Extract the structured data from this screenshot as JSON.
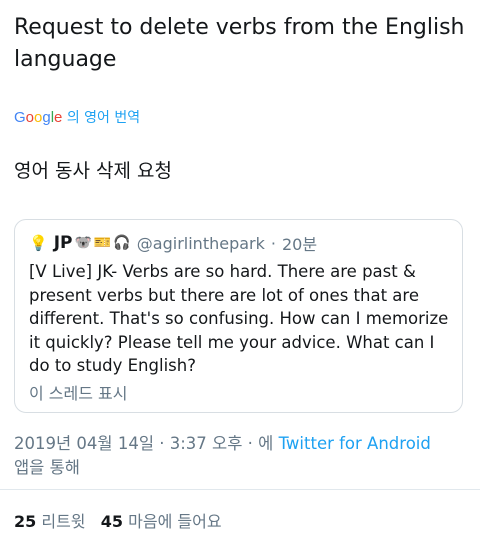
{
  "tweet": {
    "text": "Request to delete verbs from the English language"
  },
  "translation": {
    "provider": "Google",
    "label": "의 영어 번역",
    "text": "영어 동사 삭제 요청"
  },
  "quote": {
    "author_name": "JP",
    "emojis": [
      "🐨",
      "🎫",
      "🎧"
    ],
    "handle": "@agirlinthepark",
    "separator": "·",
    "time": "20분",
    "text": "[V Live] JK- Verbs are so hard. There are past & present verbs but there are lot of ones that are different. That's so confusing. How can I memorize it quickly? Please tell me your advice. What can I do to study English?",
    "show_thread": "이 스레드 표시"
  },
  "meta": {
    "timestamp": "2019년 04월 14일 · 3:37 오후 · 에",
    "app": "Twitter for Android",
    "suffix": "앱을 통해"
  },
  "stats": {
    "retweets_count": "25",
    "retweets_label": "리트윗",
    "likes_count": "45",
    "likes_label": "마음에 들어요"
  },
  "colors": {
    "link": "#1da1f2",
    "secondary_text": "#657786",
    "primary_text": "#14171a"
  }
}
